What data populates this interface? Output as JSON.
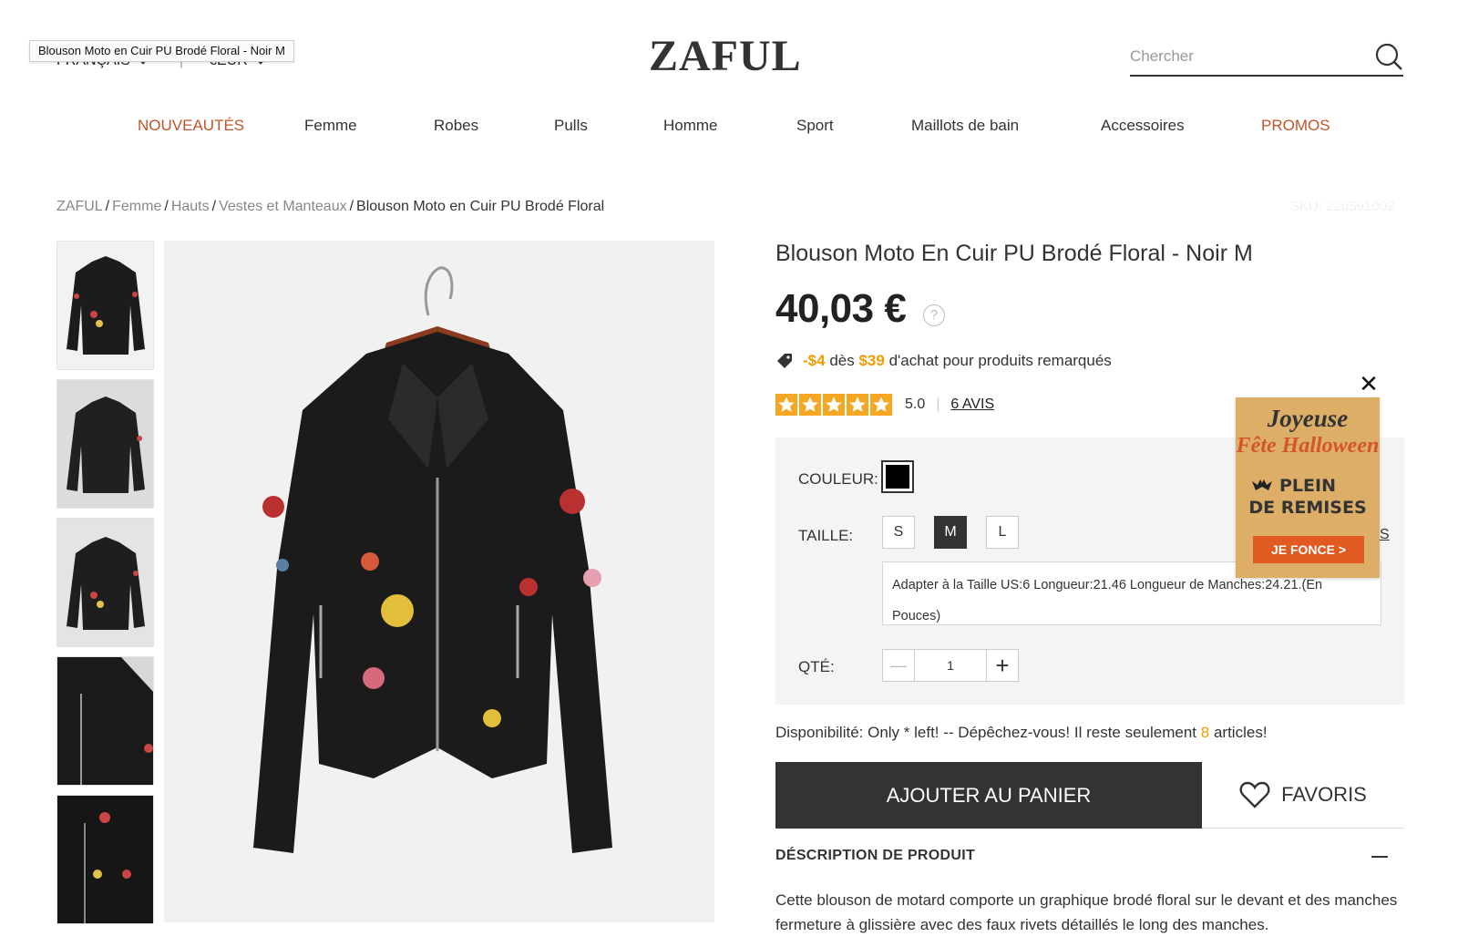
{
  "tooltip": "Blouson Moto en Cuir PU Brodé Floral - Noir M",
  "header": {
    "language": "FRANÇAIS",
    "currency": "€EUR",
    "logo": "ZAFUL",
    "search_placeholder": "Chercher"
  },
  "nav": [
    {
      "label": "NOUVEAUTÉS",
      "accent": true
    },
    {
      "label": "Femme"
    },
    {
      "label": "Robes"
    },
    {
      "label": "Pulls"
    },
    {
      "label": "Homme"
    },
    {
      "label": "Sport"
    },
    {
      "label": "Maillots de bain"
    },
    {
      "label": "Accessoires"
    },
    {
      "label": "PROMOS",
      "accent": true
    }
  ],
  "breadcrumb": {
    "items": [
      "ZAFUL",
      "Femme",
      "Hauts",
      "Vestes et Manteaux"
    ],
    "current": "Blouson Moto en Cuir PU Brodé Floral",
    "sku": "SKU: 220591002"
  },
  "product": {
    "title": "Blouson Moto En Cuir PU Brodé Floral - Noir M",
    "price": "40,03 €",
    "price_help": "?",
    "promo": {
      "discount": "-$4",
      "mid": "dès",
      "threshold": "$39",
      "rest": "d'achat pour produits remarqués"
    },
    "rating_value": 5,
    "rating": "5.0",
    "reviews": "6 AVIS",
    "color_label": "COULEUR:",
    "color_value": "#000000",
    "size_label": "TAILLE:",
    "sizes": [
      "S",
      "M",
      "L"
    ],
    "selected_size": "M",
    "size_guide_fragment": "S",
    "fit_info": "Adapter à la Taille US:6   Longueur:21.46   Longueur de Manches:24.21.(En Pouces)",
    "qty_label": "QTÉ:",
    "qty_minus": "—",
    "qty_value": "1",
    "qty_plus": "+",
    "availability": {
      "prefix": "Disponibilité: Only * left! -- Dépêchez-vous! Il reste seulement",
      "count": "8",
      "suffix": "articles!"
    },
    "add_to_cart": "AJOUTER AU PANIER",
    "favorites": "FAVORIS",
    "description_title": "DÉSCRIPTION DE PRODUIT",
    "description_text": "Cette blouson de motard comporte un graphique brodé floral sur le devant et des manches fermeture à glissière avec des faux rivets détaillés le long des manches."
  },
  "halloween_popup": {
    "close": "✕",
    "line1": "Joyeuse",
    "line2": "Fête Halloween",
    "line3": "PLEIN",
    "line4": "DE REMISES",
    "button": "JE FONCE >"
  },
  "colors": {
    "accent": "#c0542a",
    "promo_orange": "#f29b00",
    "star": "#f5a623",
    "dark": "#333333"
  }
}
